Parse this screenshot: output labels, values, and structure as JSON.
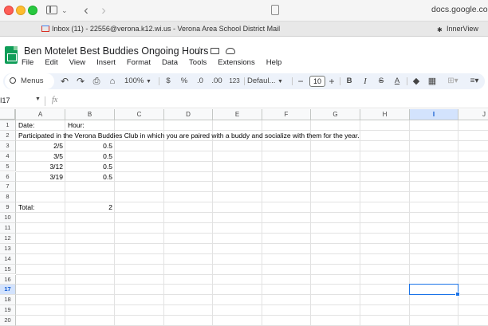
{
  "browser": {
    "url": "docs.google.com",
    "tabs": [
      {
        "title": "Inbox (11) - 22556@verona.k12.wi.us - Verona Area School District Mail"
      },
      {
        "title": "InnerView"
      }
    ]
  },
  "doc": {
    "title": "Ben Motelet Best Buddies Ongoing Hours"
  },
  "menu": [
    "File",
    "Edit",
    "View",
    "Insert",
    "Format",
    "Data",
    "Tools",
    "Extensions",
    "Help"
  ],
  "toolbar": {
    "menus_label": "Menus",
    "zoom": "100%",
    "currency": "$",
    "percent": "%",
    "dec_decrease": ".0",
    "dec_increase": ".00",
    "number_format": "123",
    "font": "Defaul...",
    "font_size": "10",
    "minus": "−",
    "plus": "+",
    "bold": "B",
    "italic": "I",
    "strike": "S",
    "text_color": "A"
  },
  "formula_bar": {
    "name_box": "I17",
    "fx": "fx"
  },
  "sheet": {
    "columns": [
      "A",
      "B",
      "C",
      "D",
      "E",
      "F",
      "G",
      "H",
      "I",
      "J"
    ],
    "selected_column": "I",
    "rows": [
      "1",
      "2",
      "3",
      "4",
      "5",
      "6",
      "7",
      "8",
      "9",
      "10",
      "11",
      "12",
      "13",
      "14",
      "15",
      "16",
      "17",
      "18",
      "19",
      "20"
    ],
    "selected_row": "17",
    "cells": {
      "A1": "Date:",
      "B1": "Hour:",
      "A2": "Participated in the Verona Buddies Club in which you are paired with a buddy and socialize with them for the year.",
      "A3": "2/5",
      "B3": "0.5",
      "A4": "3/5",
      "B4": "0.5",
      "A5": "3/12",
      "B5": "0.5",
      "A6": "3/19",
      "B6": "0.5",
      "A9": "Total:",
      "B9": "2"
    }
  },
  "colors": {
    "accent": "#1a73e8",
    "toolbar_bg": "#edf2fa",
    "selected_header": "#d3e3fd",
    "sheets_green": "#0f9d58"
  }
}
